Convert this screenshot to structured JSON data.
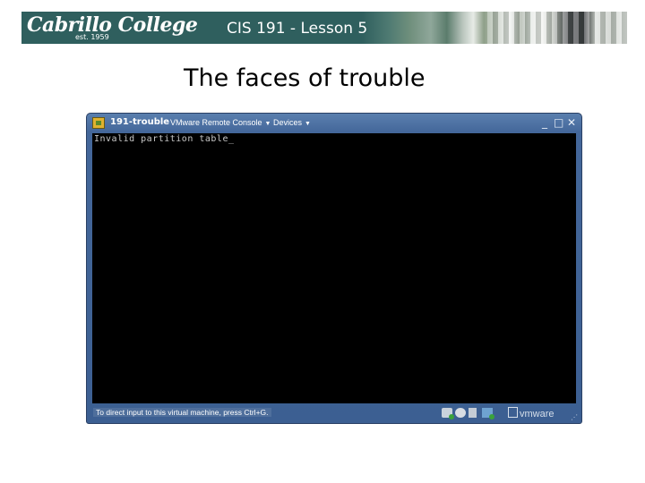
{
  "header": {
    "logo_text": "Cabrillo College",
    "logo_subtext": "est. 1959",
    "title": "CIS 191 - Lesson 5"
  },
  "slide": {
    "title": "The faces of trouble"
  },
  "vm_window": {
    "vm_name": "191-trouble",
    "menus": [
      {
        "label": "VMware Remote Console",
        "icon": "chevron-down-icon"
      },
      {
        "label": "Devices",
        "icon": "chevron-down-icon"
      }
    ],
    "window_buttons": {
      "minimize": "_",
      "maximize": "□",
      "close": "✕"
    },
    "console_output": "Invalid partition table_",
    "status_text": "To direct input to this virtual machine, press Ctrl+G.",
    "device_icons": [
      "hard-disk-icon",
      "cdrom-icon",
      "floppy-icon",
      "network-icon"
    ],
    "brand": "vmware"
  }
}
